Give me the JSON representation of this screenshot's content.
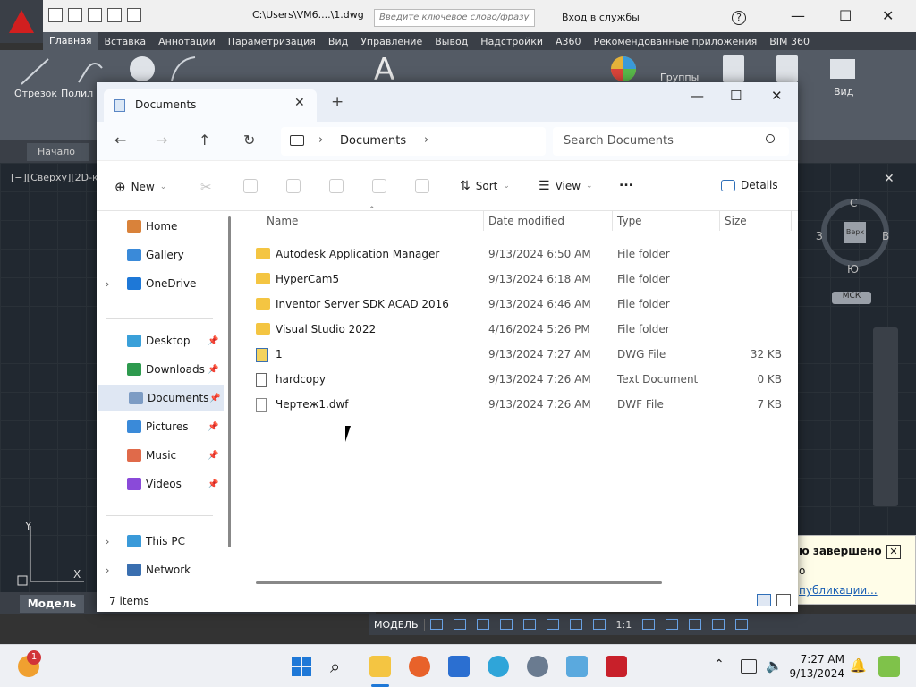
{
  "autocad": {
    "file_path": "C:\\Users\\VM6....\\1.dwg",
    "search_placeholder": "Введите ключевое слово/фразу",
    "signin": "Вход в службы",
    "ribbon_tabs": [
      "Главная",
      "Вставка",
      "Аннотации",
      "Параметризация",
      "Вид",
      "Управление",
      "Вывод",
      "Надстройки",
      "A360",
      "Рекомендованные приложения",
      "BIM 360"
    ],
    "tools": {
      "line": "Отрезок",
      "polyline": "Полил",
      "groups": "Группы",
      "view": "Вид"
    },
    "start_tab": "Начало",
    "viewport_label": "[−][Сверху][2D-ка",
    "viewcube": {
      "north": "С",
      "south": "Ю",
      "west": "З",
      "east": "В",
      "face": "Верх",
      "wcs": "МСК"
    },
    "model_tab": "Модель",
    "status_model": "МОДЕЛЬ",
    "scale": "1:1",
    "notification": {
      "title": "ю завершено",
      "line2": "о",
      "link": "публикации..."
    }
  },
  "explorer": {
    "tab_title": "Documents",
    "breadcrumb": "Documents",
    "search_placeholder": "Search Documents",
    "commands": {
      "new": "New",
      "sort": "Sort",
      "view": "View",
      "more": "...",
      "details": "Details"
    },
    "sidebar": [
      {
        "label": "Home",
        "icon": "home-icon",
        "pinned": false,
        "expand": false
      },
      {
        "label": "Gallery",
        "icon": "gallery-icon",
        "pinned": false,
        "expand": false
      },
      {
        "label": "OneDrive",
        "icon": "onedrive-icon",
        "pinned": false,
        "expand": true
      },
      {
        "label": "Desktop",
        "icon": "desktop-icon",
        "pinned": true,
        "expand": false
      },
      {
        "label": "Downloads",
        "icon": "downloads-icon",
        "pinned": true,
        "expand": false
      },
      {
        "label": "Documents",
        "icon": "documents-icon",
        "pinned": true,
        "expand": false,
        "selected": true
      },
      {
        "label": "Pictures",
        "icon": "pictures-icon",
        "pinned": true,
        "expand": false
      },
      {
        "label": "Music",
        "icon": "music-icon",
        "pinned": true,
        "expand": false
      },
      {
        "label": "Videos",
        "icon": "videos-icon",
        "pinned": true,
        "expand": false
      },
      {
        "label": "This PC",
        "icon": "this-pc-icon",
        "pinned": false,
        "expand": true
      },
      {
        "label": "Network",
        "icon": "network-icon",
        "pinned": false,
        "expand": true
      }
    ],
    "columns": [
      "Name",
      "Date modified",
      "Type",
      "Size"
    ],
    "files": [
      {
        "name": "Autodesk Application Manager",
        "date": "9/13/2024 6:50 AM",
        "type": "File folder",
        "size": "",
        "icon": "folder"
      },
      {
        "name": "HyperCam5",
        "date": "9/13/2024 6:18 AM",
        "type": "File folder",
        "size": "",
        "icon": "folder"
      },
      {
        "name": "Inventor Server SDK ACAD 2016",
        "date": "9/13/2024 6:46 AM",
        "type": "File folder",
        "size": "",
        "icon": "folder"
      },
      {
        "name": "Visual Studio 2022",
        "date": "4/16/2024 5:26 PM",
        "type": "File folder",
        "size": "",
        "icon": "folder"
      },
      {
        "name": "1",
        "date": "9/13/2024 7:27 AM",
        "type": "DWG File",
        "size": "32 KB",
        "icon": "dwg"
      },
      {
        "name": "hardcopy",
        "date": "9/13/2024 7:26 AM",
        "type": "Text Document",
        "size": "0 KB",
        "icon": "txt"
      },
      {
        "name": "Чертеж1.dwf",
        "date": "9/13/2024 7:26 AM",
        "type": "DWF File",
        "size": "7 KB",
        "icon": "dwf"
      }
    ],
    "item_count": "7 items"
  },
  "taskbar": {
    "badge": "1",
    "time": "7:27 AM",
    "date": "9/13/2024"
  }
}
